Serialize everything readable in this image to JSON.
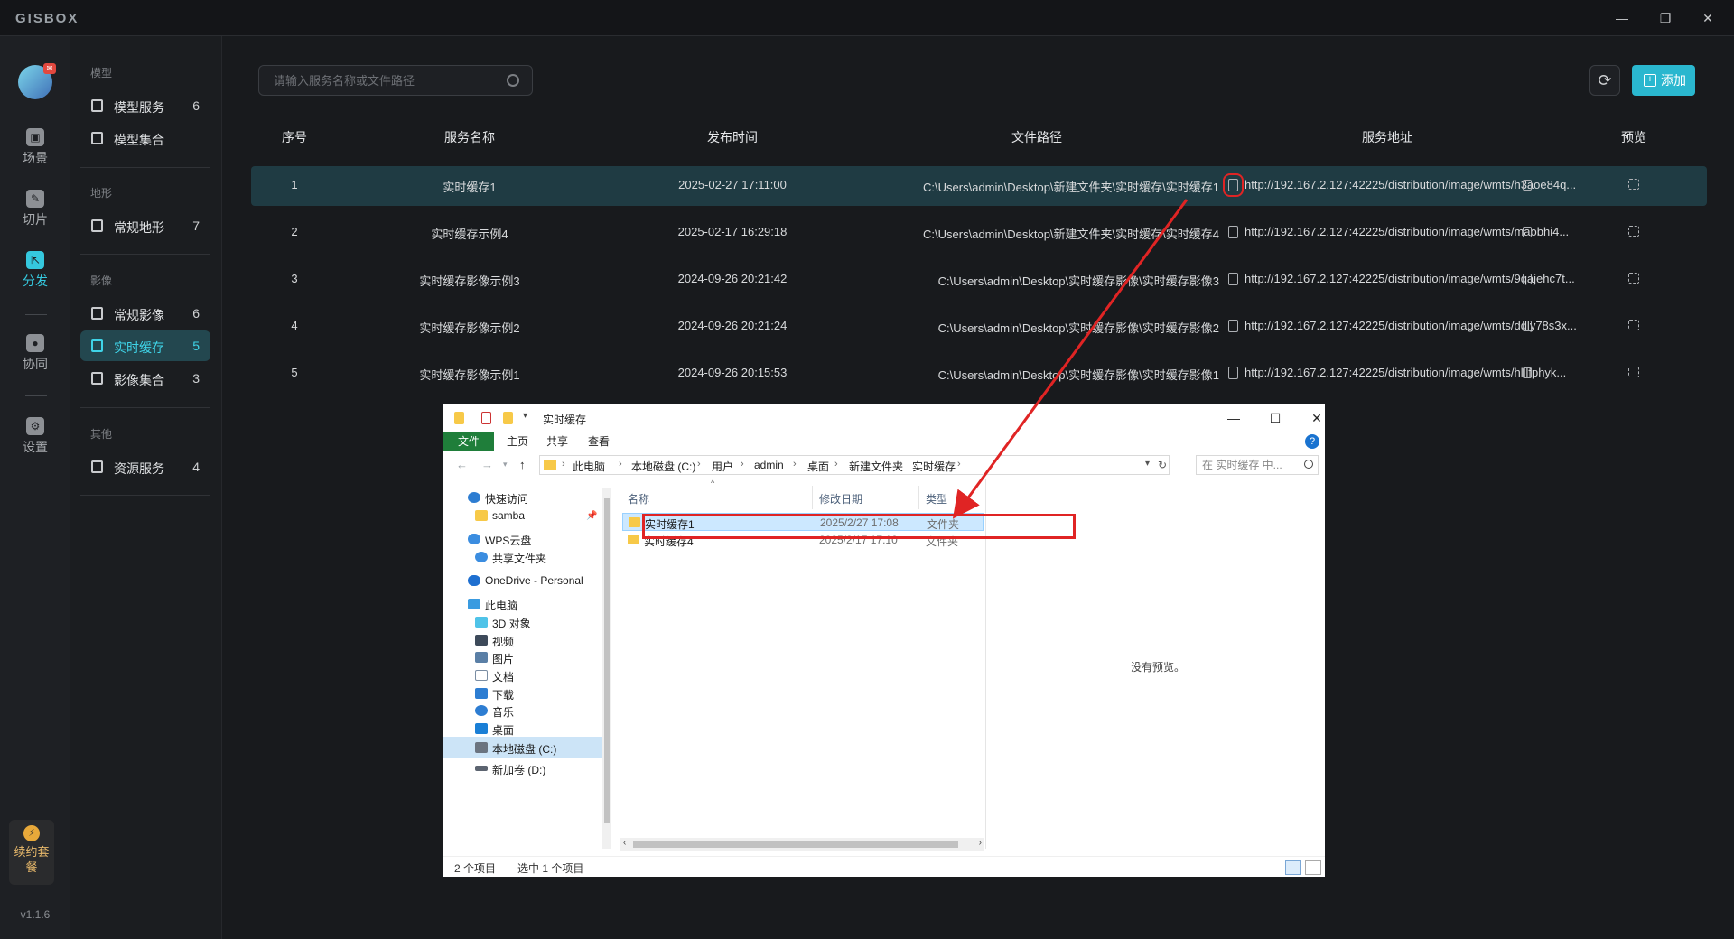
{
  "app": {
    "logo": "GISBOX",
    "version": "v1.1.6",
    "win_controls": {
      "minimize": "—",
      "restore": "❐",
      "close": "✕"
    }
  },
  "rail": {
    "items": [
      {
        "label": "场景",
        "icon": "scene-icon",
        "active": false
      },
      {
        "label": "切片",
        "icon": "slice-icon",
        "active": false
      },
      {
        "label": "分发",
        "icon": "distribute-icon",
        "active": true
      },
      {
        "label": "协同",
        "icon": "collaborate-icon",
        "active": false
      },
      {
        "label": "设置",
        "icon": "settings-icon",
        "active": false
      }
    ],
    "renew_label": "续约套餐"
  },
  "sidebar": {
    "groups": [
      {
        "title": "模型",
        "items": [
          {
            "label": "模型服务",
            "count": "6"
          },
          {
            "label": "模型集合",
            "count": ""
          }
        ]
      },
      {
        "title": "地形",
        "items": [
          {
            "label": "常规地形",
            "count": "7"
          }
        ]
      },
      {
        "title": "影像",
        "items": [
          {
            "label": "常规影像",
            "count": "6"
          },
          {
            "label": "实时缓存",
            "count": "5",
            "active": true
          },
          {
            "label": "影像集合",
            "count": "3"
          }
        ]
      },
      {
        "title": "其他",
        "items": [
          {
            "label": "资源服务",
            "count": "4"
          }
        ]
      }
    ]
  },
  "toolbar": {
    "search_placeholder": "请输入服务名称或文件路径",
    "refresh_icon": "refresh-icon",
    "add_label": "添加"
  },
  "table": {
    "headers": [
      "序号",
      "服务名称",
      "发布时间",
      "文件路径",
      "服务地址",
      "预览"
    ],
    "rows": [
      {
        "idx": "1",
        "name": "实时缓存1",
        "time": "2025-02-27 17:11:00",
        "path": "C:\\Users\\admin\\Desktop\\新建文件夹\\实时缓存\\实时缓存1",
        "url": "http://192.167.2.127:42225/distribution/image/wmts/h3aoe84q..."
      },
      {
        "idx": "2",
        "name": "实时缓存示例4",
        "time": "2025-02-17 16:29:18",
        "path": "C:\\Users\\admin\\Desktop\\新建文件夹\\实时缓存\\实时缓存4",
        "url": "http://192.167.2.127:42225/distribution/image/wmts/maobhi4..."
      },
      {
        "idx": "3",
        "name": "实时缓存影像示例3",
        "time": "2024-09-26 20:21:42",
        "path": "C:\\Users\\admin\\Desktop\\实时缓存影像\\实时缓存影像3",
        "url": "http://192.167.2.127:42225/distribution/image/wmts/9qajehc7t..."
      },
      {
        "idx": "4",
        "name": "实时缓存影像示例2",
        "time": "2024-09-26 20:21:24",
        "path": "C:\\Users\\admin\\Desktop\\实时缓存影像\\实时缓存影像2",
        "url": "http://192.167.2.127:42225/distribution/image/wmts/ddly78s3x..."
      },
      {
        "idx": "5",
        "name": "实时缓存影像示例1",
        "time": "2024-09-26 20:15:53",
        "path": "C:\\Users\\admin\\Desktop\\实时缓存影像\\实时缓存影像1",
        "url": "http://192.167.2.127:42225/distribution/image/wmts/hlllfphyk..."
      }
    ]
  },
  "explorer": {
    "title": "实时缓存",
    "ribbon_tabs": [
      "文件",
      "主页",
      "共享",
      "查看"
    ],
    "breadcrumb": [
      "此电脑",
      "本地磁盘 (C:)",
      "用户",
      "admin",
      "桌面",
      "新建文件夹",
      "实时缓存"
    ],
    "search_placeholder": "在 实时缓存 中...",
    "nav": {
      "quick_access": "快速访问",
      "samba": "samba",
      "wps": "WPS云盘",
      "shared": "共享文件夹",
      "onedrive": "OneDrive - Personal",
      "this_pc": "此电脑",
      "objects3d": "3D 对象",
      "videos": "视频",
      "pictures": "图片",
      "documents": "文档",
      "downloads": "下载",
      "music": "音乐",
      "desktop": "桌面",
      "drive_c": "本地磁盘 (C:)",
      "drive_d": "新加卷 (D:)"
    },
    "columns": [
      "名称",
      "修改日期",
      "类型"
    ],
    "files": [
      {
        "name": "实时缓存1",
        "date": "2025/2/27 17:08",
        "type": "文件夹",
        "selected": true
      },
      {
        "name": "实时缓存4",
        "date": "2025/2/17 17:10",
        "type": "文件夹",
        "selected": false
      }
    ],
    "preview_msg": "没有预览。",
    "status_count": "2 个项目",
    "status_selected": "选中 1 个项目"
  },
  "colors": {
    "accent": "#2ab7cf",
    "active_bg": "#23474f",
    "highlight_red": "#e02424",
    "explorer_file_tab": "#1f7e3a"
  }
}
